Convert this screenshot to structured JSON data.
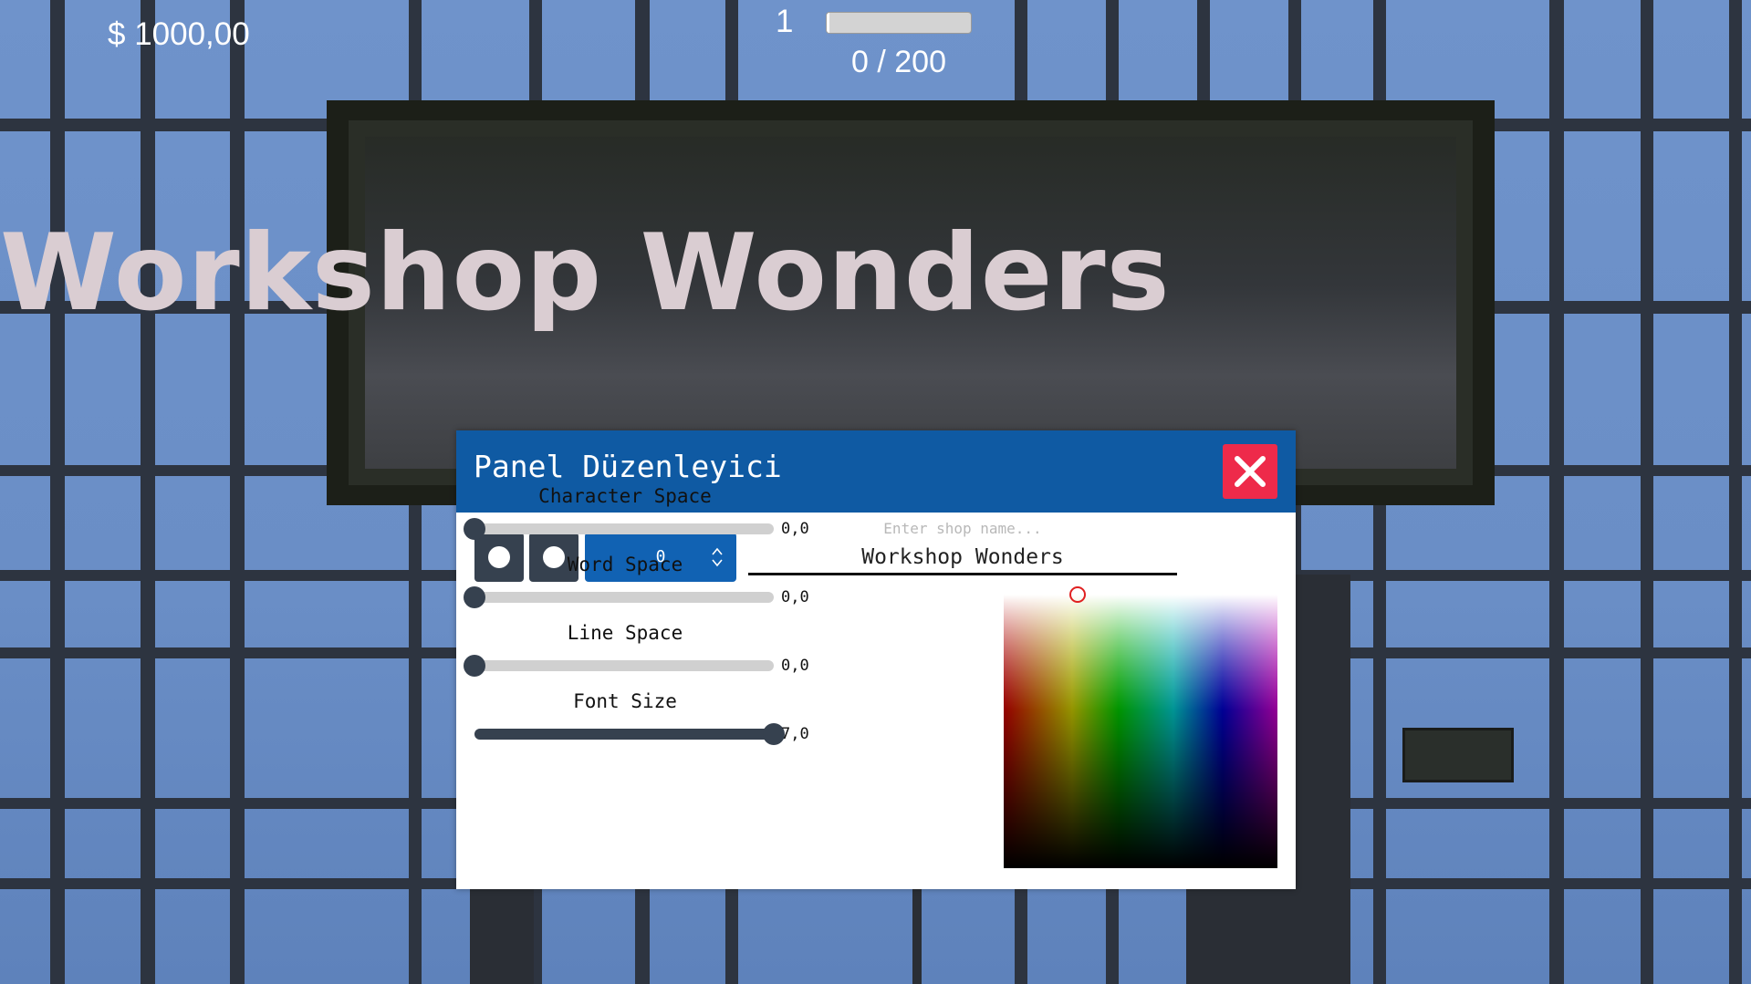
{
  "hud": {
    "money": "$ 1000,00",
    "level": "1",
    "xp_text": "0 / 200",
    "xp_fraction": 0.0
  },
  "sign": {
    "text": "Workshop Wonders",
    "text_color": "#dacdd2"
  },
  "panel": {
    "title": "Panel Düzenleyici",
    "accent_color": "#0f5aa3",
    "close_color": "#ee2a4a",
    "close_icon": "close-icon",
    "style_buttons": [
      "circle-icon",
      "circle-icon"
    ],
    "number_field": {
      "value": "0"
    },
    "shop_name": {
      "placeholder": "Enter shop name...",
      "value": "Workshop Wonders"
    },
    "sliders": [
      {
        "label": "Character Space",
        "value_text": "0,0",
        "fraction": 0.0
      },
      {
        "label": "Word Space",
        "value_text": "0,0",
        "fraction": 0.0
      },
      {
        "label": "Line Space",
        "value_text": "0,0",
        "fraction": 0.0
      },
      {
        "label": "Font Size",
        "value_text": "7,0",
        "fraction": 1.0
      }
    ],
    "color_picker": {
      "selected_hue_fraction": 0.27,
      "selected_brightness_fraction": 0.0
    }
  }
}
